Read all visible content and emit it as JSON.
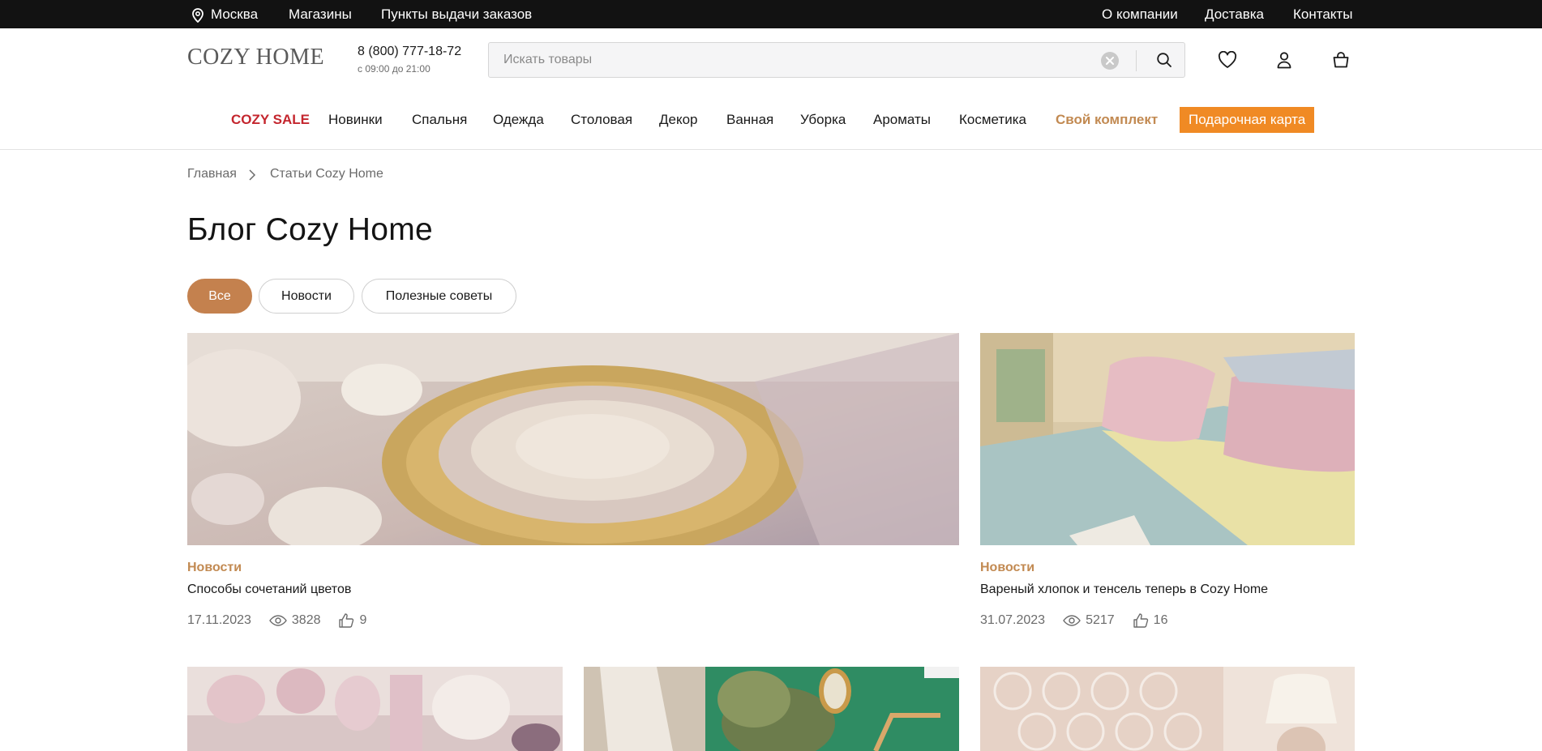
{
  "topbar": {
    "city": "Москва",
    "stores": "Магазины",
    "pickup": "Пункты выдачи заказов",
    "about": "О компании",
    "delivery": "Доставка",
    "contacts": "Контакты"
  },
  "header": {
    "logo": "COZY HOME",
    "phone": "8 (800) 777-18-72",
    "hours": "с 09:00 до 21:00",
    "search_placeholder": "Искать товары",
    "search_value": ""
  },
  "nav": {
    "sale": "COZY SALE",
    "new": "Новинки",
    "bedroom": "Спальня",
    "clothes": "Одежда",
    "dining": "Столовая",
    "decor": "Декор",
    "bath": "Ванная",
    "cleaning": "Уборка",
    "aromas": "Ароматы",
    "cosmetics": "Косметика",
    "kit": "Свой комплект",
    "gift_card": "Подарочная карта"
  },
  "breadcrumb": {
    "home": "Главная",
    "current": "Статьи Cozy Home"
  },
  "page_title": "Блог Cozy Home",
  "filters": {
    "all": "Все",
    "news": "Новости",
    "tips": "Полезные советы",
    "active": "Все"
  },
  "colors": {
    "accent": "#c4814e",
    "sale": "#c4262e",
    "gift": "#f08a24",
    "category": "#c28a52",
    "topbar": "#121212"
  },
  "articles": [
    {
      "category": "Новости",
      "title": "Способы сочетаний цветов",
      "date": "17.11.2023",
      "views": "3828",
      "likes": "9"
    },
    {
      "category": "Новости",
      "title": "Вареный хлопок и тенсель теперь в Cozy Home",
      "date": "31.07.2023",
      "views": "5217",
      "likes": "16"
    }
  ],
  "icons": {
    "location": "location-pin-icon",
    "clear": "clear-icon",
    "search": "search-icon",
    "wishlist": "heart-icon",
    "account": "user-icon",
    "cart": "bag-icon",
    "breadcrumb_sep": "chevron-right-icon",
    "views": "eye-icon",
    "likes": "thumb-up-icon"
  }
}
